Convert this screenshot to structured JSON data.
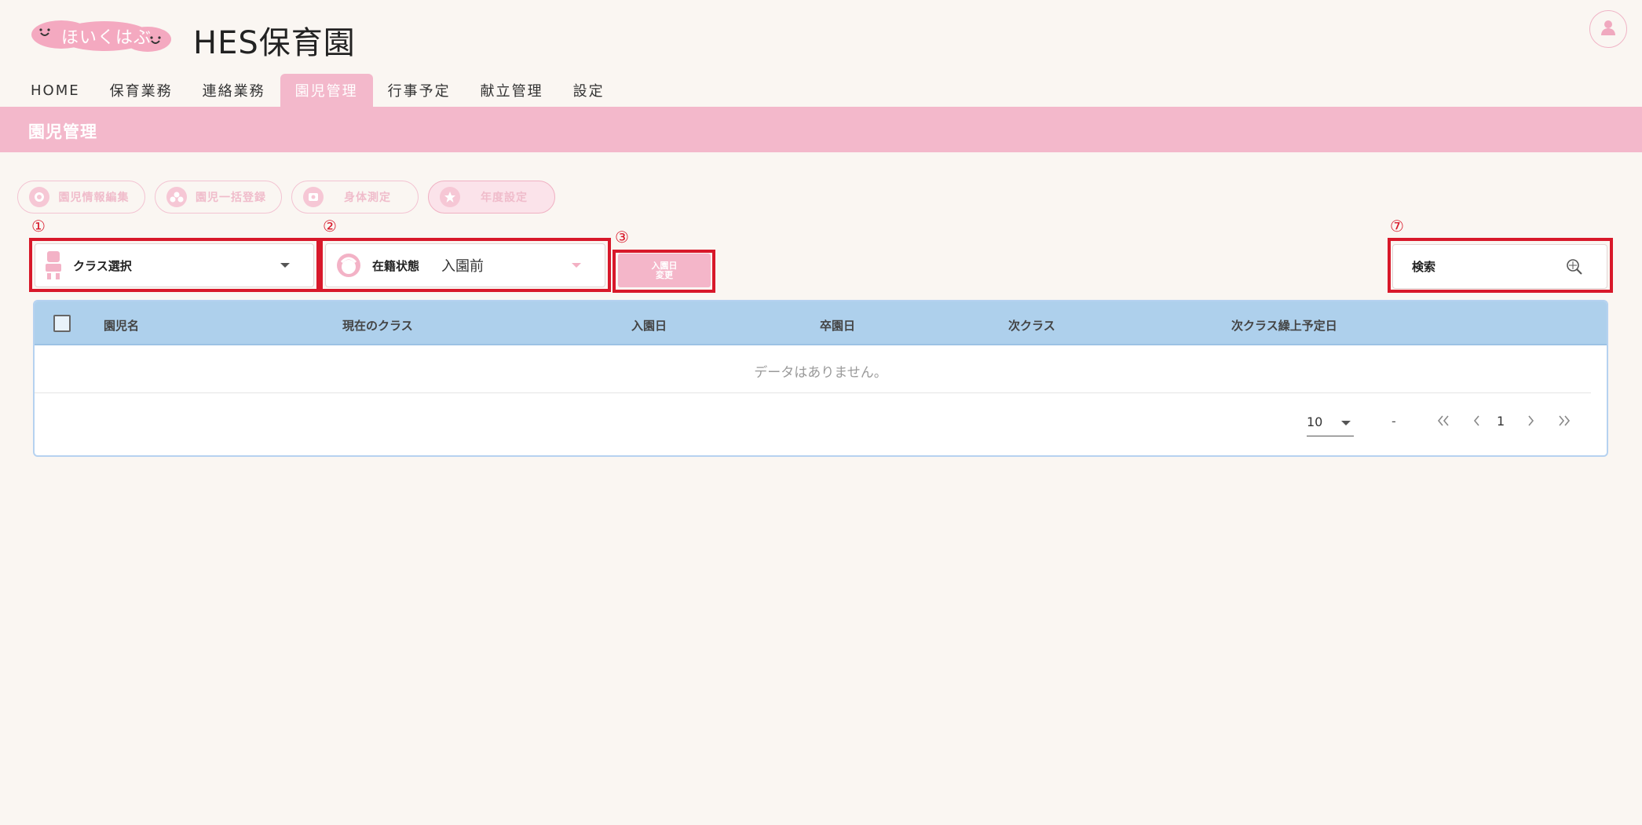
{
  "header": {
    "logo_text": "ほいくはぶ",
    "app_title": "HES保育園",
    "colors": {
      "brand_pink": "#f3b8cb",
      "logo_pink": "#f4a9c0",
      "header_blue": "#aed0ec",
      "annotation_red": "#d8182a"
    },
    "avatar_icon": "user-icon"
  },
  "nav": {
    "tabs": [
      {
        "label": "HOME"
      },
      {
        "label": "保育業務"
      },
      {
        "label": "連絡業務"
      },
      {
        "label": "園児管理"
      },
      {
        "label": "行事予定"
      },
      {
        "label": "献立管理"
      },
      {
        "label": "設定"
      }
    ],
    "active_tab": "園児管理"
  },
  "section": {
    "title": "園児管理"
  },
  "actions": {
    "buttons": [
      {
        "label": "園児情報編集",
        "icon": "child-icon"
      },
      {
        "label": "園児一括登録",
        "icon": "group-icon"
      },
      {
        "label": "身体測定",
        "icon": "scale-icon"
      },
      {
        "label": "年度設定",
        "icon": "gear-star-icon"
      }
    ],
    "selected": "年度設定"
  },
  "markers": {
    "m1": "①",
    "m2": "②",
    "m3": "③",
    "m7": "⑦"
  },
  "filters": {
    "class_select": {
      "label": "クラス選択",
      "icon": "class-icon"
    },
    "enrollment_select": {
      "label": "在籍状態",
      "value": "入園前",
      "icon": "child-face-icon"
    },
    "change_button": {
      "line1": "入園日",
      "line2": "変更"
    },
    "search": {
      "label": "検索",
      "icon": "search-icon"
    }
  },
  "table": {
    "columns": [
      "園児名",
      "現在のクラス",
      "入園日",
      "卒園日",
      "次クラス",
      "次クラス繰上予定日"
    ],
    "rows": [],
    "empty_message": "データはありません。",
    "pagination": {
      "rows_per_page": "10",
      "range": "-",
      "page": "1"
    }
  }
}
